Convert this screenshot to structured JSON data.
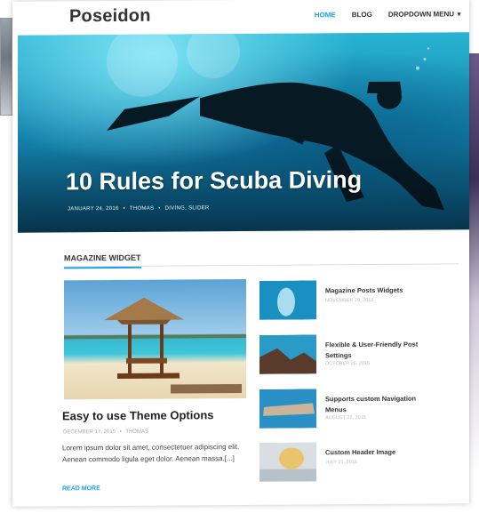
{
  "site": {
    "brand": "Poseidon"
  },
  "nav": {
    "items": [
      {
        "label": "HOME",
        "active": true
      },
      {
        "label": "BLOG",
        "active": false
      },
      {
        "label": "DROPDOWN MENU",
        "active": false
      }
    ],
    "dropdown_icon": "chevron-down-icon"
  },
  "hero": {
    "title": "10 Rules for Scuba Diving",
    "date": "JANUARY 24, 2016",
    "author": "THOMAS",
    "categories": "DIVING, SLIDER"
  },
  "widget": {
    "title": "MAGAZINE WIDGET"
  },
  "main_post": {
    "title": "Easy to use Theme Options",
    "date": "DECEMBER 17, 2015",
    "author": "THOMAS",
    "excerpt": "Lorem ipsum dolor sit amet, consectetuer adipiscing elit. Aenean commodo ligula eget dolor. Aenean massa.[...]",
    "read_more": "READ MORE"
  },
  "side_posts": [
    {
      "title": "Magazine Posts Widgets",
      "date": "NOVEMBER 28, 2015"
    },
    {
      "title": "Flexible & User-Friendly Post Settings",
      "date": "OCTOBER 26, 2015"
    },
    {
      "title": "Supports custom Navigation Menus",
      "date": "AUGUST 22, 2015"
    },
    {
      "title": "Custom Header Image",
      "date": "JULY 21, 2015"
    }
  ],
  "colors": {
    "accent": "#1ba1e2",
    "text": "#333333"
  }
}
